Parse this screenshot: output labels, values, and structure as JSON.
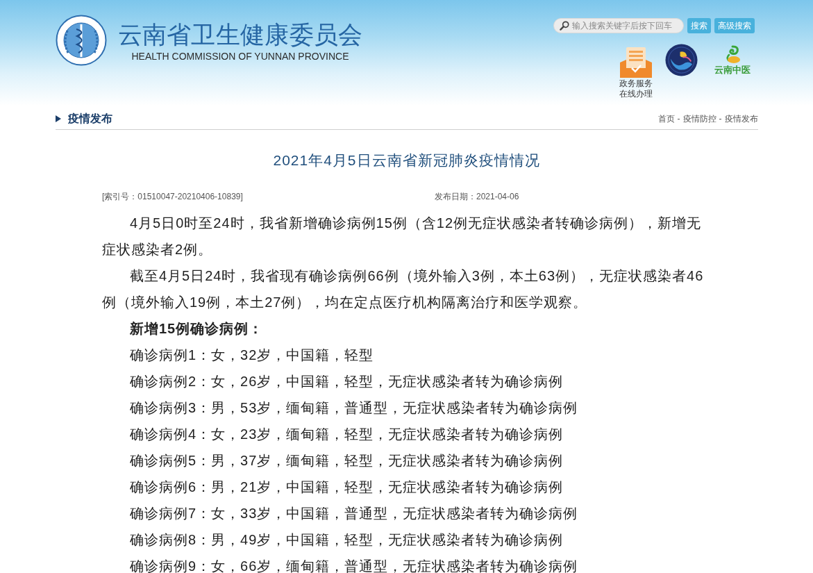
{
  "header": {
    "title": "云南省卫生健康委员会",
    "subtitle": "HEALTH COMMISSION OF YUNNAN PROVINCE",
    "search": {
      "placeholder": "输入搜索关键字后按下回车"
    },
    "buttons": [
      "搜索",
      "高级搜索"
    ],
    "quick_links": [
      {
        "kind": "service",
        "label_lines": [
          "政务服务",
          "在线办理"
        ]
      },
      {
        "kind": "emblem"
      },
      {
        "kind": "logo",
        "label_lines": [
          "云南中医"
        ]
      }
    ]
  },
  "section": {
    "title": "疫情发布",
    "breadcrumb": {
      "items": [
        "首页",
        "疫情防控",
        "疫情发布"
      ],
      "separator": "-"
    }
  },
  "article": {
    "title": "2021年4月5日云南省新冠肺炎疫情情况",
    "index": "[索引号：01510047-20210406-10839]",
    "date": "发布日期：2021-04-06",
    "paragraphs": [
      "4月5日0时至24时，我省新增确诊病例15例（含12例无症状感染者转确诊病例），新增无症状感染者2例。",
      "截至4月5日24时，我省现有确诊病例66例（境外输入3例，本土63例），无症状感染者46例（境外输入19例，本土27例），均在定点医疗机构隔离治疗和医学观察。"
    ],
    "cases_heading": "新增15例确诊病例：",
    "cases": [
      "确诊病例1：女，32岁，中国籍，轻型",
      "确诊病例2：女，26岁，中国籍，轻型，无症状感染者转为确诊病例",
      "确诊病例3：男，53岁，缅甸籍，普通型，无症状感染者转为确诊病例",
      "确诊病例4：女，23岁，缅甸籍，轻型，无症状感染者转为确诊病例",
      "确诊病例5：男，37岁，缅甸籍，轻型，无症状感染者转为确诊病例",
      "确诊病例6：男，21岁，中国籍，轻型，无症状感染者转为确诊病例",
      "确诊病例7：女，33岁，中国籍，普通型，无症状感染者转为确诊病例",
      "确诊病例8：男，49岁，中国籍，轻型，无症状感染者转为确诊病例",
      "确诊病例9：女，66岁，缅甸籍，普通型，无症状感染者转为确诊病例"
    ]
  }
}
